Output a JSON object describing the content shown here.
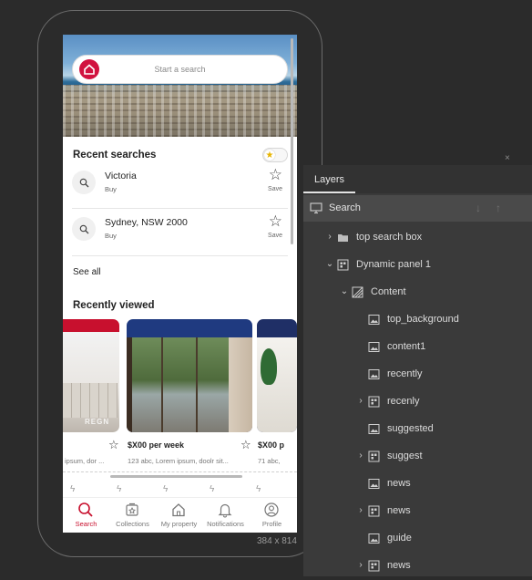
{
  "app": {
    "search_placeholder": "Start a search",
    "recent_searches_title": "Recent searches",
    "recent_searches": [
      {
        "name": "Victoria",
        "sub": "Buy",
        "action": "Save"
      },
      {
        "name": "Sydney, NSW 2000",
        "sub": "Buy",
        "action": "Save"
      }
    ],
    "see_all": "See all",
    "recently_viewed_title": "Recently viewed",
    "cards": [
      {
        "price": "",
        "address": "ipsum, dor ...",
        "watermark": "REGN"
      },
      {
        "price": "$X00 per week",
        "address": "123 abc, Lorem ipsum, doolr sit..."
      },
      {
        "price": "$X00 p",
        "address": "71 abc,"
      }
    ],
    "nav": [
      {
        "label": "Search",
        "icon": "search-icon",
        "active": true
      },
      {
        "label": "Collections",
        "icon": "collections-icon",
        "active": false
      },
      {
        "label": "My property",
        "icon": "home-icon",
        "active": false
      },
      {
        "label": "Notifications",
        "icon": "bell-icon",
        "active": false
      },
      {
        "label": "Profile",
        "icon": "profile-icon",
        "active": false
      }
    ],
    "accent": "#c8102e"
  },
  "canvas": {
    "size_label": "384 x 814"
  },
  "layers": {
    "close": "×",
    "tab_label": "Layers",
    "page_name": "Search",
    "items": [
      {
        "label": "top search box",
        "type": "folder",
        "expandable": true,
        "expanded": false,
        "level": 1
      },
      {
        "label": "Dynamic panel 1",
        "type": "panel",
        "expandable": true,
        "expanded": true,
        "level": 1
      },
      {
        "label": "Content",
        "type": "state",
        "expandable": true,
        "expanded": true,
        "level": 2
      },
      {
        "label": "top_background",
        "type": "image",
        "expandable": false,
        "level": 3
      },
      {
        "label": "content1",
        "type": "image",
        "expandable": false,
        "level": 3
      },
      {
        "label": "recently",
        "type": "image",
        "expandable": false,
        "level": 3
      },
      {
        "label": "recenly",
        "type": "panel",
        "expandable": true,
        "expanded": false,
        "level": 3
      },
      {
        "label": "suggested",
        "type": "image",
        "expandable": false,
        "level": 3
      },
      {
        "label": "suggest",
        "type": "panel",
        "expandable": true,
        "expanded": false,
        "level": 3
      },
      {
        "label": "news",
        "type": "image",
        "expandable": false,
        "level": 3
      },
      {
        "label": "news",
        "type": "panel",
        "expandable": true,
        "expanded": false,
        "level": 3
      },
      {
        "label": "guide",
        "type": "image",
        "expandable": false,
        "level": 3
      },
      {
        "label": "news",
        "type": "panel",
        "expandable": true,
        "expanded": false,
        "level": 3
      }
    ]
  }
}
